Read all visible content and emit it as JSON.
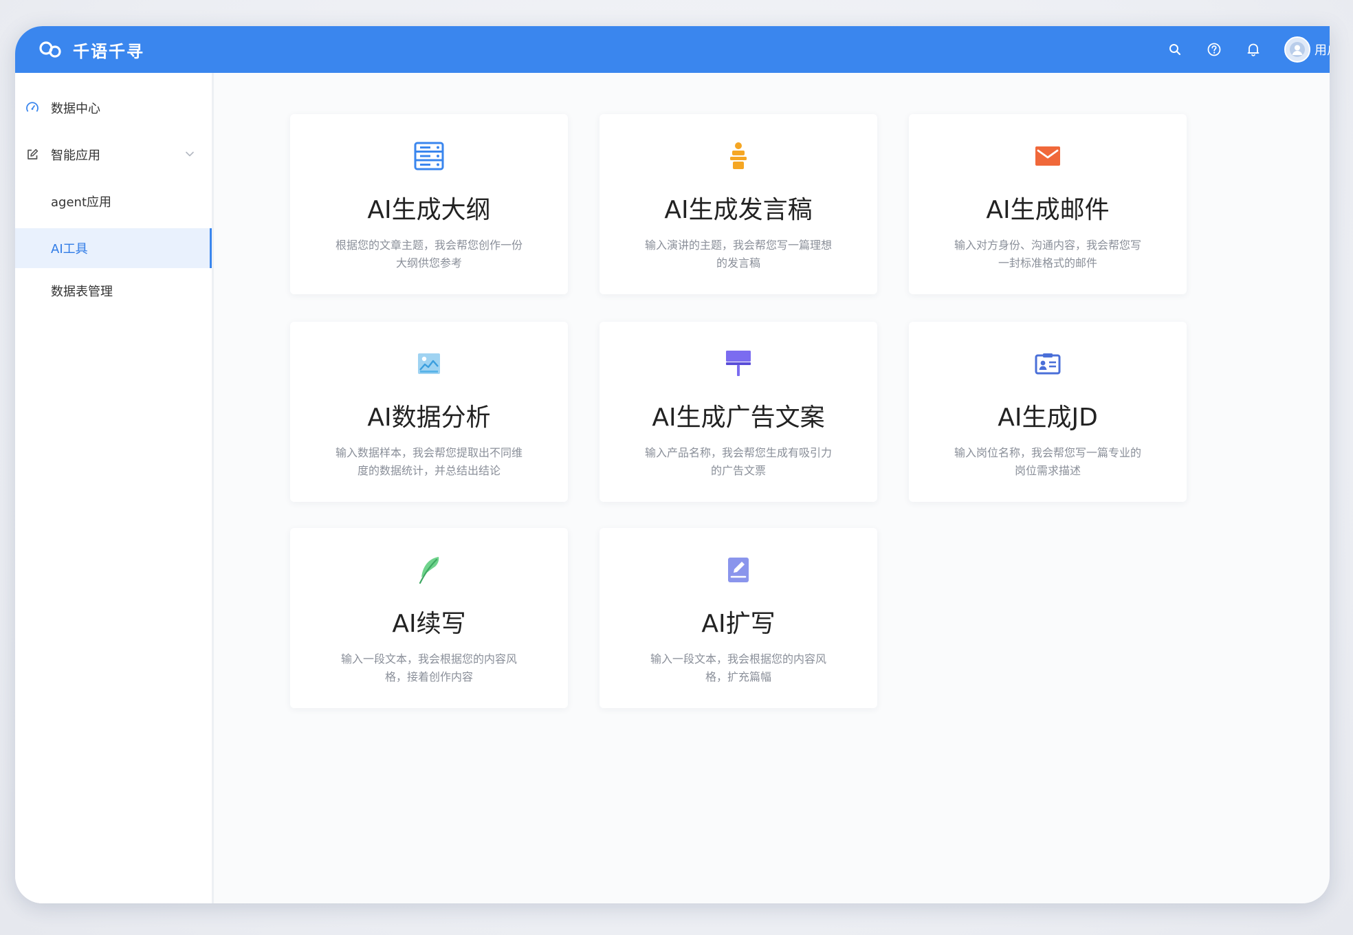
{
  "app": {
    "title": "千语千寻",
    "username": "用户"
  },
  "header": {
    "icons": [
      "search-icon",
      "help-icon",
      "bell-icon",
      "avatar"
    ]
  },
  "sidebar": {
    "items": [
      {
        "label": "数据中心",
        "icon": "dashboard-icon"
      },
      {
        "label": "智能应用",
        "icon": "edit-icon",
        "expanded": true
      },
      {
        "label": "agent应用",
        "sub": true
      },
      {
        "label": "AI工具",
        "sub": true,
        "active": true
      },
      {
        "label": "数据表管理",
        "sub": true
      }
    ]
  },
  "cards": [
    {
      "title": "AI生成大纲",
      "desc": "根据您的文章主题，我会帮您创作一份大纲供您参考",
      "icon": "outline-icon"
    },
    {
      "title": "AI生成发言稿",
      "desc": "输入演讲的主题，我会帮您写一篇理想的发言稿",
      "icon": "speech-icon"
    },
    {
      "title": "AI生成邮件",
      "desc": "输入对方身份、沟通内容，我会帮您写一封标准格式的邮件",
      "icon": "mail-icon"
    },
    {
      "title": "AI数据分析",
      "desc": "输入数据样本，我会帮您提取出不同维度的数据统计，并总结出结论",
      "icon": "chart-image-icon"
    },
    {
      "title": "AI生成广告文案",
      "desc": "输入产品名称，我会帮您生成有吸引力的广告文票",
      "icon": "billboard-icon"
    },
    {
      "title": "AI生成JD",
      "desc": "输入岗位名称，我会帮您写一篇专业的岗位需求描述",
      "icon": "id-card-icon"
    },
    {
      "title": "AI续写",
      "desc": "输入一段文本，我会根据您的内容风格，接着创作内容",
      "icon": "feather-icon"
    },
    {
      "title": "AI扩写",
      "desc": "输入一段文本，我会根据您的内容风格，扩充篇幅",
      "icon": "document-edit-icon"
    }
  ],
  "colors": {
    "accent": "#3a86ee",
    "outline": "#3a86ee",
    "speech": "#f5a623",
    "mail": "#f0683a",
    "chart": "#5ab4e8",
    "billboard": "#7b6cf0",
    "idcard": "#4a6fd8",
    "feather": "#5bc97a",
    "docedit": "#7a86e8"
  }
}
